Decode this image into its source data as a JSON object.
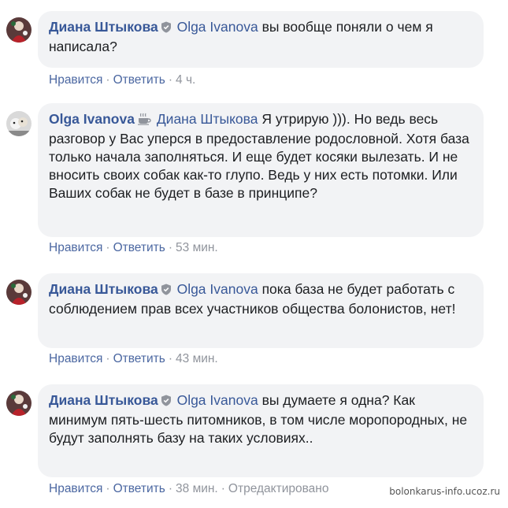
{
  "comments": [
    {
      "author": "Диана Штыкова",
      "author_badge": "shield-icon",
      "mention": "Olga Ivanova",
      "text": " вы вообще поняли о чем я написала?",
      "like": "Нравится",
      "reply": "Ответить",
      "time": "4 ч.",
      "edited": ""
    },
    {
      "author": "Olga Ivanova",
      "author_badge": "coffee-cup-icon",
      "mention": "Диана Штыкова",
      "text": " Я утрирую ))). Но ведь весь разговор у Вас уперся в предоставление родословной. Хотя база только начала заполняться. И еще будет косяки вылезать. И не вносить своих собак как-то глупо. Ведь у них есть потомки. Или Ваших собак не будет в базе в принципе?",
      "like": "Нравится",
      "reply": "Ответить",
      "time": "53 мин.",
      "edited": ""
    },
    {
      "author": "Диана Штыкова",
      "author_badge": "shield-icon",
      "mention": "Olga Ivanova",
      "text": " пока база не будет работать с соблюдением прав всех участников общества болонистов, нет!",
      "like": "Нравится",
      "reply": "Ответить",
      "time": "43 мин.",
      "edited": ""
    },
    {
      "author": "Диана Штыкова",
      "author_badge": "shield-icon",
      "mention": "Olga Ivanova",
      "text": " вы думаете я одна? Как минимум пять-шесть питомников, в том числе моропородных, не будут заполнять базу на таких условиях..",
      "like": "Нравится",
      "reply": "Ответить",
      "time": "38 мин.",
      "edited": "Отредактировано"
    }
  ],
  "watermark": "bolonkarus-info.ucoz.ru",
  "colors": {
    "bubble": "#f2f3f5",
    "name": "#385898",
    "action_link": "#4b67a1",
    "meta": "#90949c"
  }
}
